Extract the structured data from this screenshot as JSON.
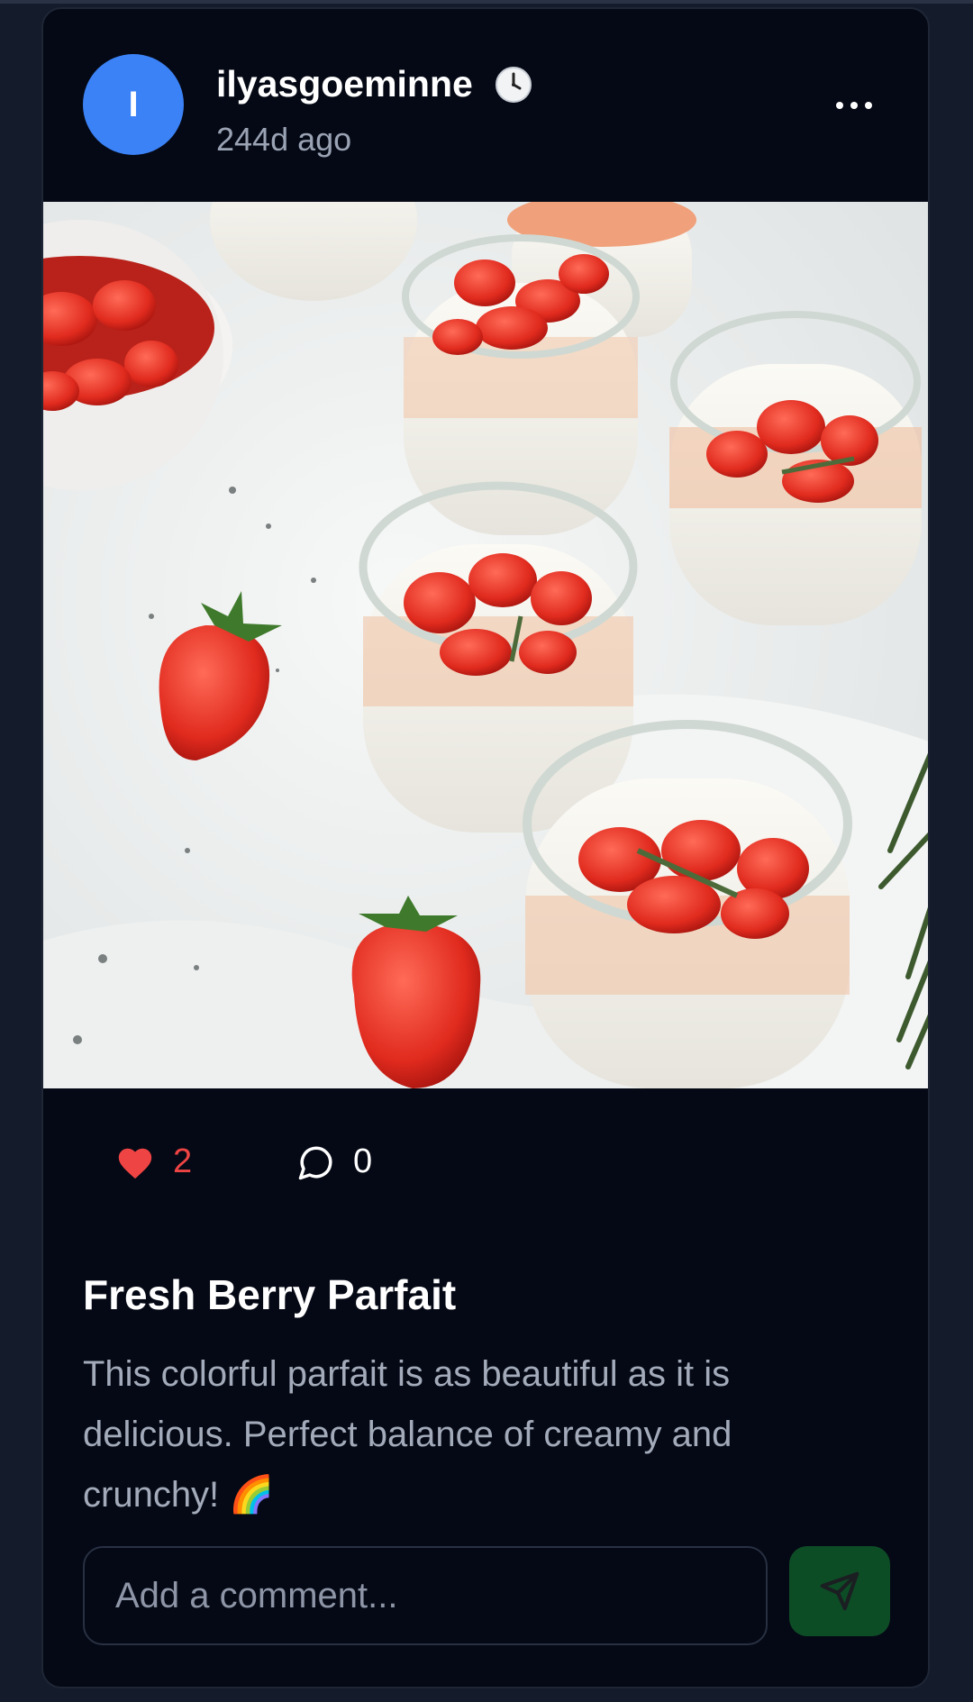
{
  "post": {
    "author": {
      "initial": "I",
      "username": "ilyasgoeminne",
      "time_ago": "244d ago"
    },
    "likes": "2",
    "comments": "0",
    "title": "Fresh Berry Parfait",
    "body": "This colorful parfait is as beautiful as it is delicious. Perfect balance of creamy and crunchy! 🌈"
  },
  "comment_box": {
    "placeholder": "Add a comment..."
  },
  "icons": {
    "clock": "clock-icon",
    "more": "more-options-icon",
    "like": "heart-icon",
    "comment": "comment-bubble-icon",
    "send": "send-icon"
  },
  "colors": {
    "background": "#141b2b",
    "card": "#050915",
    "avatar": "#3b82f6",
    "like": "#ef4444",
    "send_button": "#0d4d26"
  }
}
